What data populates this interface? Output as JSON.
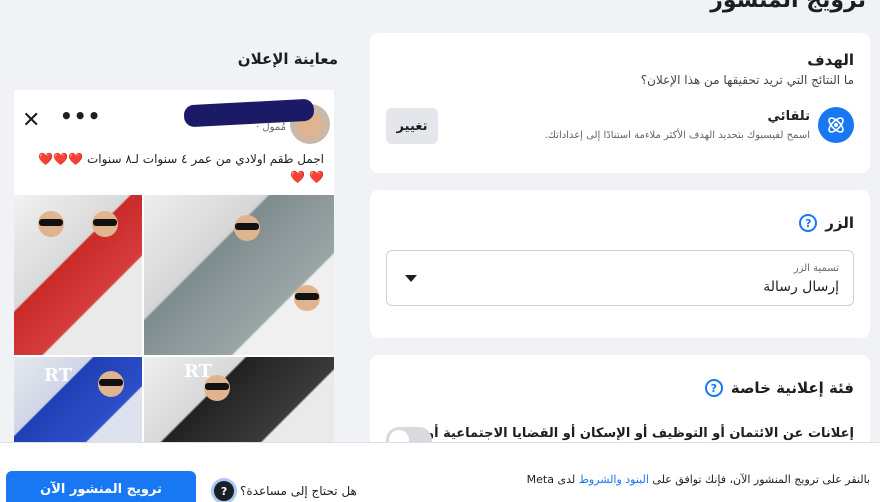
{
  "header": {
    "title": "ترويج المنشور"
  },
  "goal": {
    "title": "الهدف",
    "question": "ما النتائج التي تريد تحقيقها من هذا الإعلان؟",
    "name": "تلقائي",
    "description": "اسمح لفيسبوك بتحديد الهدف الأكثر ملاءمة استنادًا إلى إعداداتك.",
    "change_label": "تغيير"
  },
  "button_section": {
    "title": "الزر",
    "select_label": "تسمية الزر",
    "select_value": "إرسال رسالة"
  },
  "category": {
    "title": "فئة إعلانية خاصة",
    "text": "إعلانات عن الائتمان أو التوظيف أو الإسكان أو القضايا الاجتماعية أو الانتخابات أو"
  },
  "preview": {
    "title": "معاينة الإعلان",
    "sponsored": "مُمول ·",
    "ad_text": "اجمل طقم اولادي من عمر ٤ سنوات لـ٨ سنوات",
    "hearts": "❤️❤️❤️❤️ ❤️",
    "logo_text": "RT"
  },
  "footer": {
    "promote_label": "ترويج المنشور الآن",
    "help_label": "هل تحتاج إلى مساعدة؟",
    "terms_prefix": "بالنقر على ترويج المنشور الآن، فإنك توافق على",
    "terms_link": "البنود والشروط",
    "terms_suffix": "لدى Meta"
  },
  "colors": {
    "accent": "#1877f2",
    "background": "#f0f2f5"
  }
}
